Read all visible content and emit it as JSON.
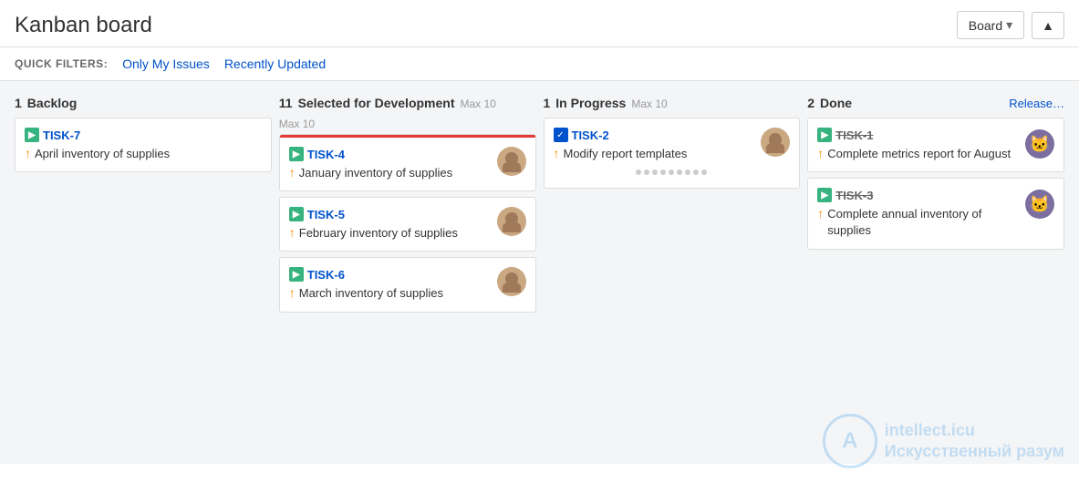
{
  "header": {
    "title": "Kanban board",
    "board_button_label": "Board",
    "collapse_icon": "▲"
  },
  "quick_filters": {
    "label": "QUICK FILTERS:",
    "items": [
      {
        "id": "only-my-issues",
        "label": "Only My Issues"
      },
      {
        "id": "recently-updated",
        "label": "Recently Updated"
      }
    ]
  },
  "columns": [
    {
      "id": "backlog",
      "count": "1",
      "title": "Backlog",
      "max_label": "",
      "extra_link": "",
      "has_red_bar": false,
      "cards": [
        {
          "id": "TISK-7",
          "title": "April inventory of supplies",
          "type": "story",
          "type_icon": "■",
          "priority": "↑",
          "has_avatar": true,
          "avatar_type": "none",
          "has_red_bar": false,
          "strikethrough": false,
          "has_dots": false
        }
      ]
    },
    {
      "id": "selected-for-development",
      "count": "11",
      "title": "Selected for Development",
      "max_label": "Max 10",
      "extra_link": "",
      "has_red_bar": true,
      "cards": [
        {
          "id": "TISK-4",
          "title": "January inventory of supplies",
          "type": "story",
          "priority": "↑",
          "has_avatar": true,
          "avatar_type": "person",
          "has_red_bar": true,
          "strikethrough": false,
          "has_dots": false
        },
        {
          "id": "TISK-5",
          "title": "February inventory of supplies",
          "type": "story",
          "priority": "↑",
          "has_avatar": true,
          "avatar_type": "person",
          "has_red_bar": false,
          "strikethrough": false,
          "has_dots": false
        },
        {
          "id": "TISK-6",
          "title": "March inventory of supplies",
          "type": "story",
          "priority": "↑",
          "has_avatar": true,
          "avatar_type": "person",
          "has_red_bar": false,
          "strikethrough": false,
          "has_dots": false
        }
      ]
    },
    {
      "id": "in-progress",
      "count": "1",
      "title": "In Progress",
      "max_label": "Max 10",
      "extra_link": "",
      "has_red_bar": false,
      "cards": [
        {
          "id": "TISK-2",
          "title": "Modify report templates",
          "type": "checkbox",
          "priority": "↑",
          "has_avatar": true,
          "avatar_type": "person",
          "has_red_bar": false,
          "strikethrough": false,
          "has_dots": true
        }
      ]
    },
    {
      "id": "done",
      "count": "2",
      "title": "Done",
      "max_label": "",
      "extra_link": "Release…",
      "has_red_bar": false,
      "cards": [
        {
          "id": "TISK-1",
          "title": "Complete metrics report for August",
          "type": "story",
          "priority": "↑",
          "has_avatar": true,
          "avatar_type": "cat",
          "has_red_bar": false,
          "strikethrough": true,
          "has_dots": false
        },
        {
          "id": "TISK-3",
          "title": "Complete annual inventory of supplies",
          "type": "story",
          "priority": "↑",
          "has_avatar": true,
          "avatar_type": "cat",
          "has_red_bar": false,
          "strikethrough": true,
          "has_dots": false
        }
      ]
    }
  ],
  "watermark": {
    "logo": "A",
    "line1": "intellect.icu",
    "line2": "Искусственный разум"
  }
}
